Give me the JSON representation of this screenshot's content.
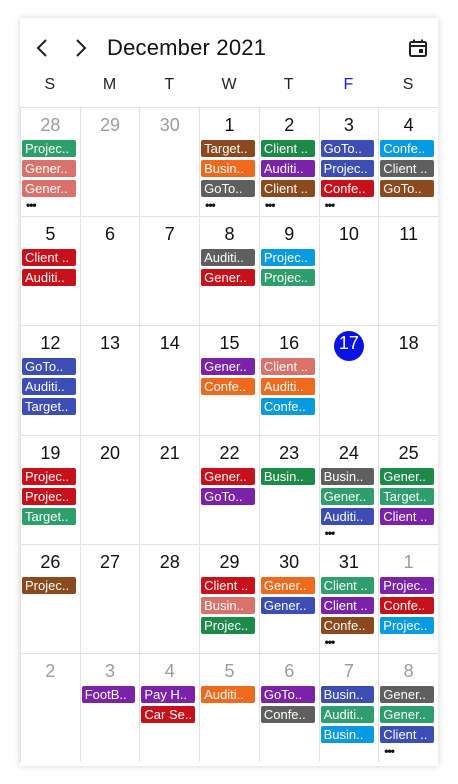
{
  "header": {
    "title": "December 2021",
    "prev_icon": "chevron-left-icon",
    "next_icon": "chevron-right-icon",
    "calendar_icon": "calendar-icon"
  },
  "weekdays": [
    {
      "label": "S",
      "color": "#222222"
    },
    {
      "label": "M",
      "color": "#222222"
    },
    {
      "label": "T",
      "color": "#222222"
    },
    {
      "label": "W",
      "color": "#222222"
    },
    {
      "label": "T",
      "color": "#222222"
    },
    {
      "label": "F",
      "color": "#1a1ae6"
    },
    {
      "label": "S",
      "color": "#222222"
    }
  ],
  "colors": {
    "green": "#2e9e6d",
    "salmon": "#d9726a",
    "brown": "#8a4a1e",
    "orange": "#ef6a1c",
    "gray": "#5f5f5f",
    "teal": "#1e8a4a",
    "purple": "#7a23a8",
    "blue": "#3c4eb3",
    "red": "#c8101b",
    "sky": "#069be0",
    "today": "#0a13e6"
  },
  "weeks": [
    [
      {
        "day": "28",
        "muted": true,
        "appts": [
          {
            "text": "Projec..",
            "color": "green"
          },
          {
            "text": "Gener..",
            "color": "salmon"
          },
          {
            "text": "Gener..",
            "color": "salmon"
          }
        ],
        "more": true
      },
      {
        "day": "29",
        "muted": true,
        "appts": []
      },
      {
        "day": "30",
        "muted": true,
        "appts": []
      },
      {
        "day": "1",
        "appts": [
          {
            "text": "Target..",
            "color": "brown"
          },
          {
            "text": "Busin..",
            "color": "orange"
          },
          {
            "text": "GoTo..",
            "color": "gray"
          }
        ],
        "more": true
      },
      {
        "day": "2",
        "appts": [
          {
            "text": "Client ..",
            "color": "teal"
          },
          {
            "text": "Auditi..",
            "color": "purple"
          },
          {
            "text": "Client ..",
            "color": "brown"
          }
        ],
        "more": true
      },
      {
        "day": "3",
        "appts": [
          {
            "text": "GoTo..",
            "color": "blue"
          },
          {
            "text": "Projec..",
            "color": "blue"
          },
          {
            "text": "Confe..",
            "color": "red"
          }
        ],
        "more": true
      },
      {
        "day": "4",
        "appts": [
          {
            "text": "Confe..",
            "color": "sky"
          },
          {
            "text": "Client ..",
            "color": "gray"
          },
          {
            "text": "GoTo..",
            "color": "brown"
          }
        ]
      }
    ],
    [
      {
        "day": "5",
        "appts": [
          {
            "text": "Client ..",
            "color": "red"
          },
          {
            "text": "Auditi..",
            "color": "red"
          }
        ]
      },
      {
        "day": "6",
        "appts": []
      },
      {
        "day": "7",
        "appts": []
      },
      {
        "day": "8",
        "appts": [
          {
            "text": "Auditi..",
            "color": "gray"
          },
          {
            "text": "Gener..",
            "color": "red"
          }
        ]
      },
      {
        "day": "9",
        "appts": [
          {
            "text": "Projec..",
            "color": "sky"
          },
          {
            "text": "Projec..",
            "color": "green"
          }
        ]
      },
      {
        "day": "10",
        "appts": []
      },
      {
        "day": "11",
        "appts": []
      }
    ],
    [
      {
        "day": "12",
        "appts": [
          {
            "text": "GoTo..",
            "color": "blue"
          },
          {
            "text": "Auditi..",
            "color": "blue"
          },
          {
            "text": "Target..",
            "color": "blue"
          }
        ]
      },
      {
        "day": "13",
        "appts": []
      },
      {
        "day": "14",
        "appts": []
      },
      {
        "day": "15",
        "appts": [
          {
            "text": "Gener..",
            "color": "purple"
          },
          {
            "text": "Confe..",
            "color": "orange"
          }
        ]
      },
      {
        "day": "16",
        "appts": [
          {
            "text": "Client ..",
            "color": "salmon"
          },
          {
            "text": "Auditi..",
            "color": "orange"
          },
          {
            "text": "Confe..",
            "color": "sky"
          }
        ]
      },
      {
        "day": "17",
        "today": true,
        "appts": []
      },
      {
        "day": "18",
        "appts": []
      }
    ],
    [
      {
        "day": "19",
        "appts": [
          {
            "text": "Projec..",
            "color": "red"
          },
          {
            "text": "Projec..",
            "color": "red"
          },
          {
            "text": "Target..",
            "color": "green"
          }
        ]
      },
      {
        "day": "20",
        "appts": []
      },
      {
        "day": "21",
        "appts": []
      },
      {
        "day": "22",
        "appts": [
          {
            "text": "Gener..",
            "color": "red"
          },
          {
            "text": "GoTo..",
            "color": "purple"
          }
        ]
      },
      {
        "day": "23",
        "appts": [
          {
            "text": "Busin..",
            "color": "teal"
          }
        ]
      },
      {
        "day": "24",
        "appts": [
          {
            "text": "Busin..",
            "color": "gray"
          },
          {
            "text": "Gener..",
            "color": "green"
          },
          {
            "text": "Auditi..",
            "color": "blue"
          }
        ],
        "more": true
      },
      {
        "day": "25",
        "appts": [
          {
            "text": "Gener..",
            "color": "teal"
          },
          {
            "text": "Target..",
            "color": "green"
          },
          {
            "text": "Client ..",
            "color": "purple"
          }
        ]
      }
    ],
    [
      {
        "day": "26",
        "appts": [
          {
            "text": "Projec..",
            "color": "brown"
          }
        ]
      },
      {
        "day": "27",
        "appts": []
      },
      {
        "day": "28",
        "appts": []
      },
      {
        "day": "29",
        "appts": [
          {
            "text": "Client ..",
            "color": "red"
          },
          {
            "text": "Busin..",
            "color": "salmon"
          },
          {
            "text": "Projec..",
            "color": "teal"
          }
        ]
      },
      {
        "day": "30",
        "appts": [
          {
            "text": "Gener..",
            "color": "orange"
          },
          {
            "text": "Gener..",
            "color": "blue"
          }
        ]
      },
      {
        "day": "31",
        "appts": [
          {
            "text": "Client ..",
            "color": "green"
          },
          {
            "text": "Client ..",
            "color": "purple"
          },
          {
            "text": "Confe..",
            "color": "brown"
          }
        ],
        "more": true
      },
      {
        "day": "1",
        "muted": true,
        "appts": [
          {
            "text": "Projec..",
            "color": "purple"
          },
          {
            "text": "Confe..",
            "color": "red"
          },
          {
            "text": "Projec..",
            "color": "sky"
          }
        ]
      }
    ],
    [
      {
        "day": "2",
        "muted": true,
        "appts": []
      },
      {
        "day": "3",
        "muted": true,
        "appts": [
          {
            "text": "FootB..",
            "color": "purple"
          }
        ]
      },
      {
        "day": "4",
        "muted": true,
        "appts": [
          {
            "text": "Pay H..",
            "color": "purple"
          },
          {
            "text": "Car Se..",
            "color": "red"
          }
        ]
      },
      {
        "day": "5",
        "muted": true,
        "appts": [
          {
            "text": "Auditi..",
            "color": "orange"
          }
        ]
      },
      {
        "day": "6",
        "muted": true,
        "appts": [
          {
            "text": "GoTo..",
            "color": "purple"
          },
          {
            "text": "Confe..",
            "color": "gray"
          }
        ]
      },
      {
        "day": "7",
        "muted": true,
        "appts": [
          {
            "text": "Busin..",
            "color": "blue"
          },
          {
            "text": "Auditi..",
            "color": "green"
          },
          {
            "text": "Busin..",
            "color": "sky"
          }
        ]
      },
      {
        "day": "8",
        "muted": true,
        "appts": [
          {
            "text": "Gener..",
            "color": "gray"
          },
          {
            "text": "Gener..",
            "color": "green"
          },
          {
            "text": "Client ..",
            "color": "blue"
          }
        ],
        "more": true
      }
    ]
  ],
  "more_text": "•••"
}
